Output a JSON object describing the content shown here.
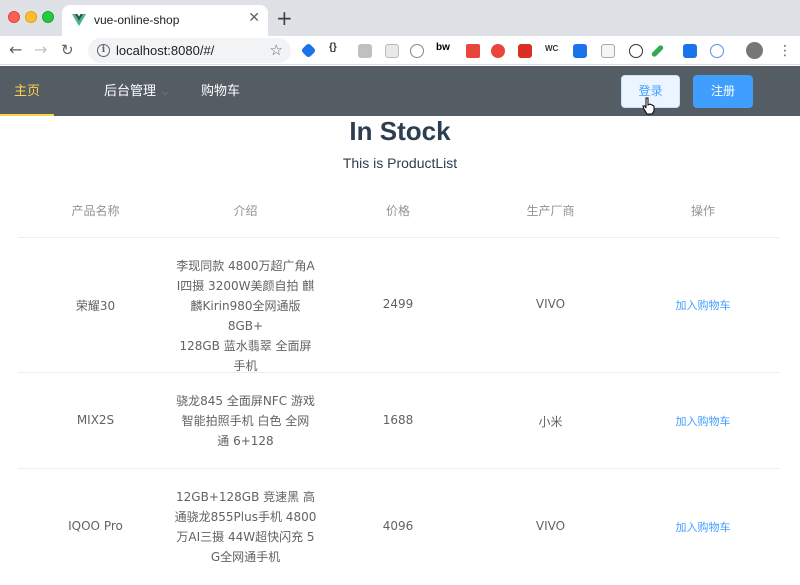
{
  "browser": {
    "tab_title": "vue-online-shop",
    "tab_close": "✕",
    "new_tab": "+",
    "url": "localhost:8080/#/",
    "star": "☆"
  },
  "nav": {
    "items": [
      {
        "label": "主页",
        "active": true
      },
      {
        "label": "后台管理",
        "submenu": true
      },
      {
        "label": "购物车"
      }
    ],
    "submenu_arrow": "⌵",
    "login_label": "登录",
    "register_label": "注册"
  },
  "page": {
    "title": "In Stock",
    "subtitle": "This is ProductList"
  },
  "table": {
    "headers": [
      "产品名称",
      "介绍",
      "价格",
      "生产厂商",
      "操作"
    ],
    "rows": [
      {
        "name": "荣耀30",
        "desc": [
          "李现同款 4800万超广角A",
          "I四摄 3200W美颜自拍 麒",
          "麟Kirin980全网通版8GB+",
          "128GB 蓝水翡翠 全面屏",
          "手机"
        ],
        "price": "2499",
        "maker": "VIVO",
        "action": "加入购物车"
      },
      {
        "name": "MIX2S",
        "desc": [
          "骁龙845 全面屏NFC 游戏",
          "智能拍照手机 白色 全网",
          "通 6+128"
        ],
        "price": "1688",
        "maker": "小米",
        "action": "加入购物车"
      },
      {
        "name": "IQOO Pro",
        "desc": [
          "12GB+128GB 竞速黑 高",
          "通骁龙855Plus手机 4800",
          "万AI三摄 44W超快闪充 5",
          "G全网通手机"
        ],
        "price": "4096",
        "maker": "VIVO",
        "action": "加入购物车"
      }
    ]
  }
}
